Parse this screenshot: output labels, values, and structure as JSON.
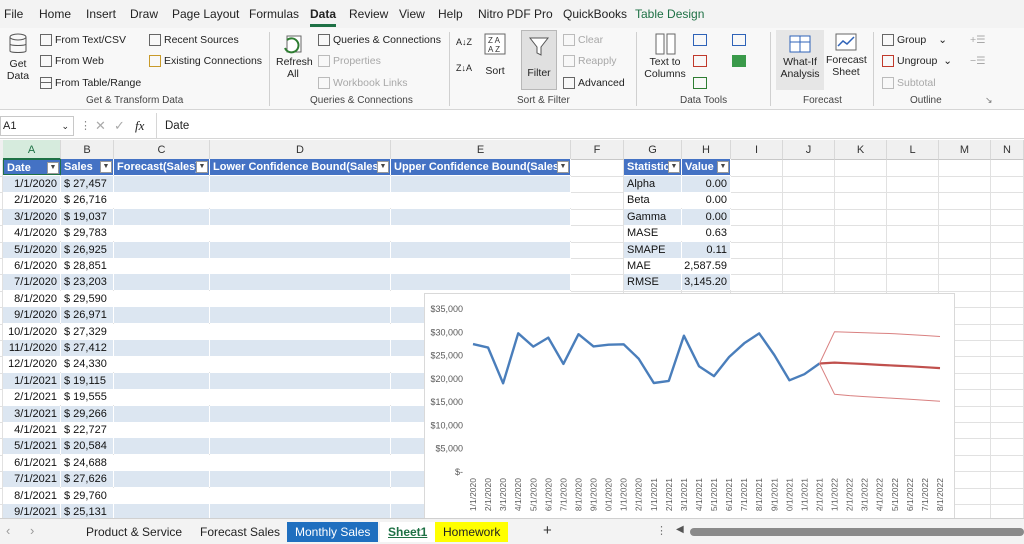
{
  "menu": [
    "File",
    "Home",
    "Insert",
    "Draw",
    "Page Layout",
    "Formulas",
    "Data",
    "Review",
    "View",
    "Help",
    "Nitro PDF Pro",
    "QuickBooks",
    "Table Design"
  ],
  "ribbon": {
    "get_data": "Get Data",
    "get_data_line1": "Get",
    "get_data_line2": "Data",
    "from_text_csv": "From Text/CSV",
    "from_web": "From Web",
    "from_table_range": "From Table/Range",
    "recent_sources": "Recent Sources",
    "existing_connections": "Existing Connections",
    "group_get_transform": "Get & Transform Data",
    "refresh_all_line1": "Refresh",
    "refresh_all_line2": "All",
    "queries_connections": "Queries & Connections",
    "properties": "Properties",
    "workbook_links": "Workbook Links",
    "group_queries": "Queries & Connections",
    "sort": "Sort",
    "filter": "Filter",
    "clear": "Clear",
    "reapply": "Reapply",
    "advanced": "Advanced",
    "group_sort_filter": "Sort & Filter",
    "text_to_columns_line1": "Text to",
    "text_to_columns_line2": "Columns",
    "group_data_tools": "Data Tools",
    "what_if_line1": "What-If",
    "what_if_line2": "Analysis",
    "forecast_sheet_line1": "Forecast",
    "forecast_sheet_line2": "Sheet",
    "group_forecast": "Forecast",
    "group": "Group",
    "ungroup": "Ungroup",
    "subtotal": "Subtotal",
    "group_outline": "Outline"
  },
  "formula_bar": {
    "name_box": "A1",
    "fx": "fx",
    "formula": "Date"
  },
  "columns": [
    "A",
    "B",
    "C",
    "D",
    "E",
    "F",
    "G",
    "H",
    "I",
    "J",
    "K",
    "L",
    "M",
    "N"
  ],
  "table_headers": [
    "Date",
    "Sales",
    "Forecast(Sales)",
    "Lower Confidence Bound(Sales)",
    "Upper Confidence Bound(Sales)"
  ],
  "rows": [
    [
      "1/1/2020",
      "$ 27,457"
    ],
    [
      "2/1/2020",
      "$ 26,716"
    ],
    [
      "3/1/2020",
      "$ 19,037"
    ],
    [
      "4/1/2020",
      "$ 29,783"
    ],
    [
      "5/1/2020",
      "$ 26,925"
    ],
    [
      "6/1/2020",
      "$ 28,851"
    ],
    [
      "7/1/2020",
      "$ 23,203"
    ],
    [
      "8/1/2020",
      "$ 29,590"
    ],
    [
      "9/1/2020",
      "$ 26,971"
    ],
    [
      "10/1/2020",
      "$ 27,329"
    ],
    [
      "11/1/2020",
      "$ 27,412"
    ],
    [
      "12/1/2020",
      "$ 24,330"
    ],
    [
      "1/1/2021",
      "$ 19,115"
    ],
    [
      "2/1/2021",
      "$ 19,555"
    ],
    [
      "3/1/2021",
      "$ 29,266"
    ],
    [
      "4/1/2021",
      "$ 22,727"
    ],
    [
      "5/1/2021",
      "$ 20,584"
    ],
    [
      "6/1/2021",
      "$ 24,688"
    ],
    [
      "7/1/2021",
      "$ 27,626"
    ],
    [
      "8/1/2021",
      "$ 29,760"
    ],
    [
      "9/1/2021",
      "$ 25,131"
    ]
  ],
  "stats_headers": [
    "Statistic",
    "Value"
  ],
  "stats": [
    [
      "Alpha",
      "0.00"
    ],
    [
      "Beta",
      "0.00"
    ],
    [
      "Gamma",
      "0.00"
    ],
    [
      "MASE",
      "0.63"
    ],
    [
      "SMAPE",
      "0.11"
    ],
    [
      "MAE",
      "2,587.59"
    ],
    [
      "RMSE",
      "3,145.20"
    ]
  ],
  "chart_data": {
    "type": "line",
    "title": "",
    "xlabel": "",
    "ylabel": "",
    "ylim": [
      0,
      35000
    ],
    "yticks": [
      "$-",
      "$5,000",
      "$10,000",
      "$15,000",
      "$20,000",
      "$25,000",
      "$30,000",
      "$35,000"
    ],
    "x": [
      "1/1/2020",
      "2/1/2020",
      "3/1/2020",
      "4/1/2020",
      "5/1/2020",
      "6/1/2020",
      "7/1/2020",
      "8/1/2020",
      "9/1/2020",
      "10/1/2020",
      "11/1/2020",
      "12/1/2020",
      "1/1/2021",
      "2/1/2021",
      "3/1/2021",
      "4/1/2021",
      "5/1/2021",
      "6/1/2021",
      "7/1/2021",
      "8/1/2021",
      "9/1/2021",
      "10/1/2021",
      "11/1/2021",
      "12/1/2021",
      "1/1/2022",
      "2/1/2022",
      "3/1/2022",
      "4/1/2022",
      "5/1/2022",
      "6/1/2022",
      "7/1/2022",
      "8/1/2022"
    ],
    "xtick_labels": [
      "1/1/2020",
      "2/1/2020",
      "3/1/2020",
      "4/1/2020",
      "5/1/2020",
      "6/1/2020",
      "7/1/2020",
      "8/1/2020",
      "9/1/2020",
      "0/1/2020",
      "1/1/2020",
      "2/1/2020",
      "1/1/2021",
      "2/1/2021",
      "3/1/2021",
      "4/1/2021",
      "5/1/2021",
      "6/1/2021",
      "7/1/2021",
      "8/1/2021",
      "9/1/2021",
      "0/1/2021",
      "1/1/2021",
      "2/1/2021",
      "1/1/2022",
      "2/1/2022",
      "3/1/2022",
      "4/1/2022",
      "5/1/2022",
      "6/1/2022",
      "7/1/2022",
      "8/1/2022"
    ],
    "series": [
      {
        "values": [
          27457,
          26716,
          19037,
          29783,
          26925,
          28851,
          23203,
          29590,
          26971,
          27329,
          27412,
          24330,
          19115,
          19555,
          29266,
          22727,
          20584,
          24688,
          27626,
          29760,
          25131,
          19700,
          21000,
          23300,
          null,
          null,
          null,
          null,
          null,
          null,
          null,
          null
        ],
        "color": "#4a7ebb"
      },
      {
        "values": [
          null,
          null,
          null,
          null,
          null,
          null,
          null,
          null,
          null,
          null,
          null,
          null,
          null,
          null,
          null,
          null,
          null,
          null,
          null,
          null,
          null,
          null,
          null,
          23300,
          23500,
          23350,
          23200,
          23000,
          22850,
          22700,
          22500,
          22300
        ],
        "color": "#c0504d"
      },
      {
        "values": [
          null,
          null,
          null,
          null,
          null,
          null,
          null,
          null,
          null,
          null,
          null,
          null,
          null,
          null,
          null,
          null,
          null,
          null,
          null,
          null,
          null,
          null,
          null,
          23300,
          16700,
          16400,
          16200,
          16000,
          15800,
          15600,
          15400,
          15200
        ],
        "color": "#d98080"
      },
      {
        "values": [
          null,
          null,
          null,
          null,
          null,
          null,
          null,
          null,
          null,
          null,
          null,
          null,
          null,
          null,
          null,
          null,
          null,
          null,
          null,
          null,
          null,
          null,
          null,
          23300,
          30100,
          30000,
          29900,
          29800,
          29700,
          29500,
          29300,
          29100
        ],
        "color": "#d98080"
      }
    ]
  },
  "sheet_tabs": [
    "Product & Service",
    "Forecast Sales",
    "Monthly Sales",
    "Sheet1",
    "Homework"
  ],
  "colors": {
    "accent": "#1e7145",
    "table_header": "#4472c4",
    "band": "#dce6f1"
  }
}
